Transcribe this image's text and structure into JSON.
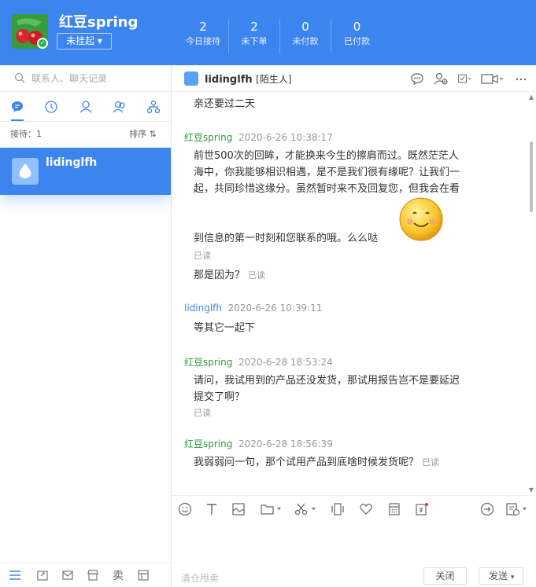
{
  "user": {
    "name": "红豆spring",
    "status": "未挂起"
  },
  "stats": [
    {
      "num": "2",
      "label": "今日接待"
    },
    {
      "num": "2",
      "label": "未下单"
    },
    {
      "num": "0",
      "label": "未付款"
    },
    {
      "num": "0",
      "label": "已付款"
    }
  ],
  "search": {
    "placeholder": "联系人、聊天记录"
  },
  "left": {
    "reception": "接待：1",
    "sort": "排序 ⇅"
  },
  "conversation": {
    "name": "lidinglfh"
  },
  "chat": {
    "name": "lidinglfh",
    "tag": "[陌生人]"
  },
  "messages": {
    "m0": {
      "body": "亲还要过二天"
    },
    "m1": {
      "name": "红豆spring",
      "time": "2020-6-26 10:38:17",
      "l1": "前世500次的回眸，才能换来今生的擦肩而过。既然茫茫人",
      "l2": "海中，你我能够相识相遇，是不是我们很有缘呢？让我们一",
      "l3": "起，共同珍惜这缘分。虽然暂时来不及回复您，但我会在看",
      "l4": "到信息的第一时刻和您联系的哦。么么哒",
      "read": "已读"
    },
    "m2": {
      "body": "那是因为？",
      "read": "已读"
    },
    "m3": {
      "name": "lidinglfh",
      "time": "2020-6-26 10:39:11",
      "body": "等其它一起下"
    },
    "m4": {
      "name": "红豆spring",
      "time": "2020-6-28 18:53:24",
      "l1": "请问，我试用到的产品还没发货，那试用报告岂不是要延迟",
      "l2": "提交了啊？",
      "read": "已读"
    },
    "m5": {
      "name": "红豆spring",
      "time": "2020-6-28 18:56:39",
      "body": "我弱弱问一句，那个试用产品到底啥时候发货呢？",
      "read": "已读"
    }
  },
  "footer": {
    "placeholder": "清仓甩卖",
    "close": "关闭",
    "send": "发送"
  },
  "left_bottom": {
    "sell": "卖"
  }
}
